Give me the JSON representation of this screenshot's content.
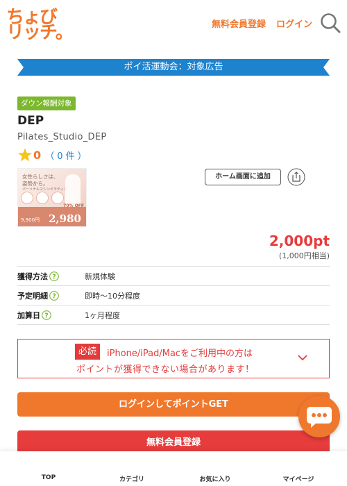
{
  "header": {
    "logo_line1": "ちょび",
    "logo_line2": "リッチ。",
    "register_label": "無料会員登録",
    "login_label": "ログイン",
    "search_icon": "search-icon"
  },
  "campaign": {
    "label": "ポイ活運動会：対象広告"
  },
  "badge": "ダウン報酬対象",
  "offer": {
    "title": "DEP",
    "subtitle": "Pilates_Studio_DEP",
    "rating_value": "0",
    "rating_count": "（ 0 件 ）",
    "thumbnail": {
      "line1": "女性らしさは、",
      "line2": "姿勢から。",
      "line3": "パーソナルマシンピラティス",
      "price_old": "9,900円",
      "price_new": "2,980",
      "off": "70% OFF"
    },
    "home_button": "ホーム画面に追加",
    "points": "2,000pt",
    "yen": "(1,000円相当)"
  },
  "info": [
    {
      "label": "獲得方法",
      "value": "新規体験"
    },
    {
      "label": "予定明細",
      "value": "即時～10分程度"
    },
    {
      "label": "加算日",
      "value": "1ヶ月程度"
    }
  ],
  "notice": {
    "must": "必読",
    "line1": "iPhone/iPad/Macをご利用中の方は",
    "line2": "ポイントが獲得できない場合があります！"
  },
  "buttons": {
    "login": "ログインしてポイントGET",
    "register": "無料会員登録"
  },
  "nav": [
    {
      "label": "TOP"
    },
    {
      "label": "カテゴリ"
    },
    {
      "label": "お気に入り"
    },
    {
      "label": "マイページ"
    }
  ],
  "colors": {
    "brand_orange": "#f0782d",
    "campaign_blue": "#1e83cf",
    "badge_green": "#7cb82f",
    "alert_red": "#e33b3b"
  }
}
